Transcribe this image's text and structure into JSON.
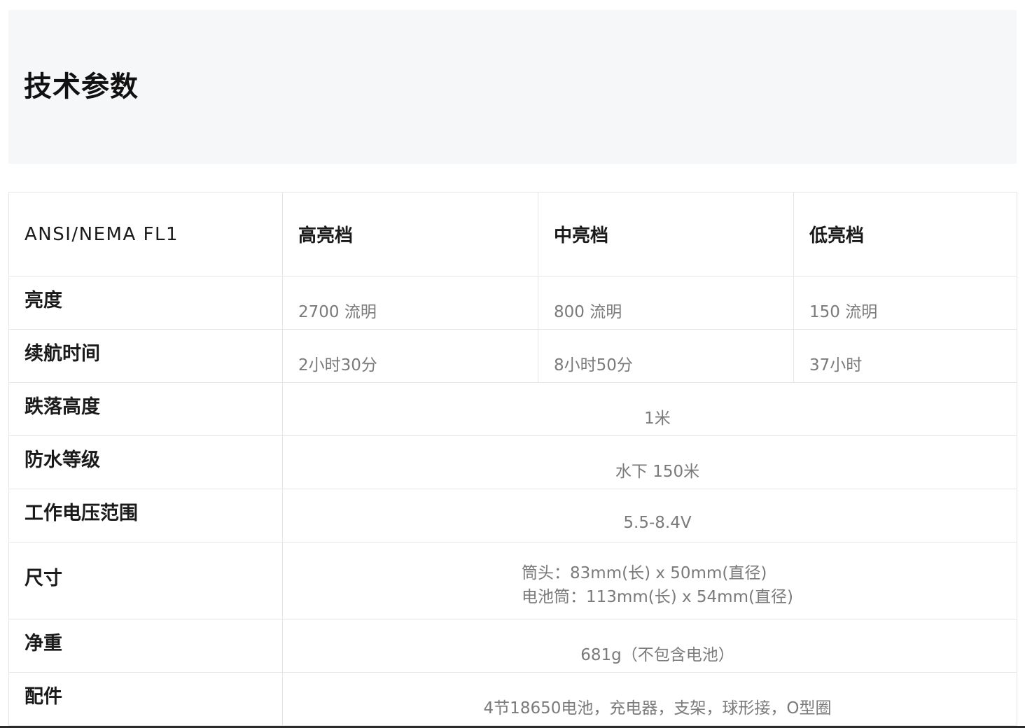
{
  "section": {
    "title": "技术参数"
  },
  "table": {
    "header": {
      "standard": "ANSI/NEMA FL1",
      "high": "高亮档",
      "mid": "中亮档",
      "low": "低亮档"
    },
    "rows": {
      "brightness": {
        "label": "亮度",
        "high": "2700 流明",
        "mid": "800 流明",
        "low": "150 流明"
      },
      "runtime": {
        "label": "续航时间",
        "high": "2小时30分",
        "mid": "8小时50分",
        "low": "37小时"
      },
      "drop": {
        "label": "跌落高度",
        "value": "1米"
      },
      "waterproof": {
        "label": "防水等级",
        "value": "水下 150米"
      },
      "voltage": {
        "label": "工作电压范围",
        "value": "5.5-8.4V"
      },
      "size": {
        "label": "尺寸",
        "line1": "筒头：83mm(长) x 50mm(直径)",
        "line2": "电池筒：113mm(长) x 54mm(直径)"
      },
      "weight": {
        "label": "净重",
        "value": "681g（不包含电池）"
      },
      "accessories": {
        "label": "配件",
        "value": "4节18650电池，充电器，支架，球形接，O型圈"
      }
    }
  }
}
